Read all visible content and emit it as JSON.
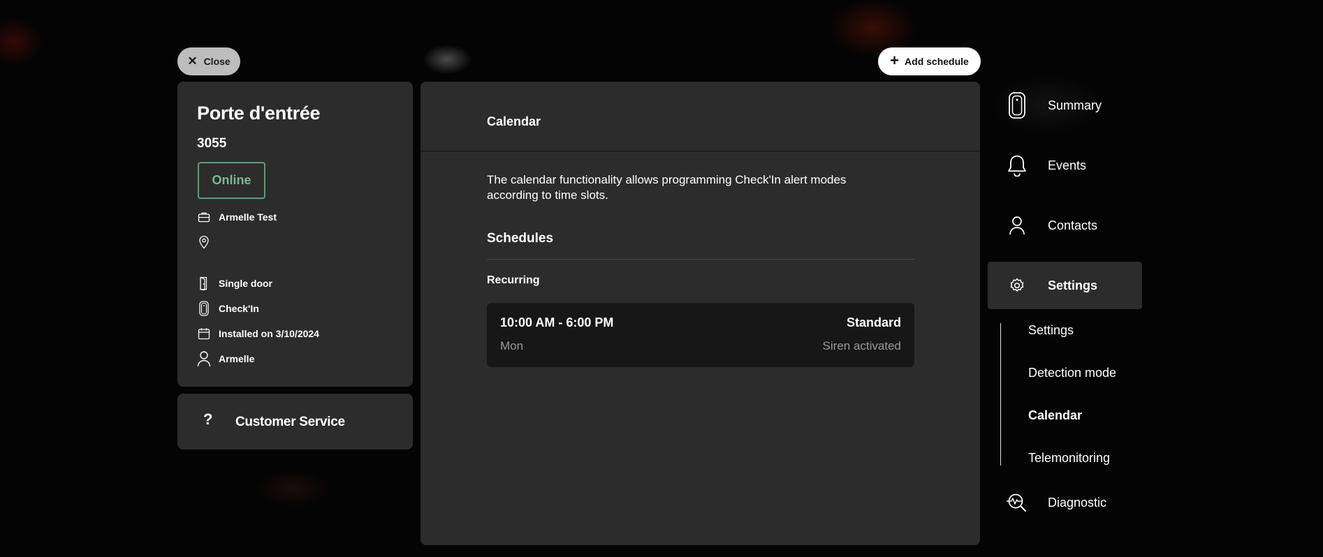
{
  "top": {
    "close_label": "Close",
    "add_schedule_label": "Add schedule"
  },
  "device": {
    "name": "Porte d'entrée",
    "id": "3055",
    "status": "Online",
    "status_color": "#7ab893",
    "owner": "Armelle Test",
    "address": "",
    "door_type": "Single door",
    "product": "Check'In",
    "installed": "Installed on 3/10/2024",
    "installer": "Armelle"
  },
  "support": {
    "icon": "question-icon",
    "label": "Customer Service"
  },
  "main": {
    "title": "Calendar",
    "description": "The calendar functionality allows programming Check'In alert modes according to time slots.",
    "schedules_title": "Schedules",
    "recurring_title": "Recurring",
    "schedules": [
      {
        "time": "10:00 AM - 6:00 PM",
        "mode": "Standard",
        "days": "Mon",
        "detail": "Siren activated"
      }
    ]
  },
  "nav": {
    "items": [
      {
        "label": "Summary",
        "icon": "device-icon"
      },
      {
        "label": "Events",
        "icon": "bell-icon"
      },
      {
        "label": "Contacts",
        "icon": "person-icon"
      },
      {
        "label": "Settings",
        "icon": "gear-icon"
      },
      {
        "label": "Diagnostic",
        "icon": "diagnostic-icon"
      }
    ],
    "active": "Settings",
    "sub_items": [
      {
        "label": "Settings"
      },
      {
        "label": "Detection mode"
      },
      {
        "label": "Calendar"
      },
      {
        "label": "Telemonitoring"
      }
    ],
    "sub_active": "Calendar"
  }
}
